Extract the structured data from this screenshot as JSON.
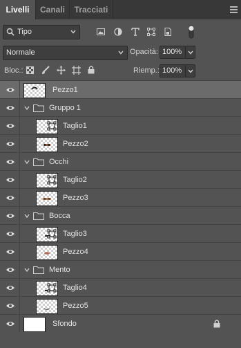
{
  "tabs": [
    {
      "label": "Livelli",
      "active": true
    },
    {
      "label": "Canali",
      "active": false
    },
    {
      "label": "Tracciati",
      "active": false
    }
  ],
  "filter": {
    "kind_label": "Tipo",
    "icons": [
      "image-filter-icon",
      "adjustment-filter-icon",
      "text-filter-icon",
      "shape-filter-icon",
      "smart-object-filter-icon",
      "filter-toggle-icon"
    ]
  },
  "blend": {
    "mode": "Normale",
    "opacity_label": "Opacità:",
    "opacity_value": "100%",
    "fill_label": "Riemp.:",
    "fill_value": "100%"
  },
  "locks": {
    "label": "Bloc.:",
    "icons": [
      "lock-transparent-icon",
      "lock-image-icon",
      "lock-position-icon",
      "lock-artboard-icon",
      "lock-all-icon"
    ]
  },
  "layers": [
    {
      "name": "Pezzo1",
      "type": "layer",
      "indent": 0,
      "selected": true
    },
    {
      "name": "Gruppo 1",
      "type": "group",
      "indent": 0
    },
    {
      "name": "Taglio1",
      "type": "adjust",
      "indent": 1
    },
    {
      "name": "Pezzo2",
      "type": "layer",
      "indent": 1
    },
    {
      "name": "Occhi",
      "type": "group",
      "indent": 0
    },
    {
      "name": "Taglio2",
      "type": "adjust",
      "indent": 1
    },
    {
      "name": "Pezzo3",
      "type": "layer",
      "indent": 1
    },
    {
      "name": "Bocca",
      "type": "group",
      "indent": 0
    },
    {
      "name": "Taglio3",
      "type": "adjust",
      "indent": 1
    },
    {
      "name": "Pezzo4",
      "type": "layer",
      "indent": 1
    },
    {
      "name": "Mento",
      "type": "group",
      "indent": 0
    },
    {
      "name": "Taglio4",
      "type": "adjust",
      "indent": 1
    },
    {
      "name": "Pezzo5",
      "type": "layer",
      "indent": 1
    },
    {
      "name": "Sfondo",
      "type": "background",
      "indent": 0,
      "locked": true
    }
  ],
  "colors": {
    "panel": "#535353",
    "tabbar": "#383838",
    "selected": "#6b6b6b"
  }
}
